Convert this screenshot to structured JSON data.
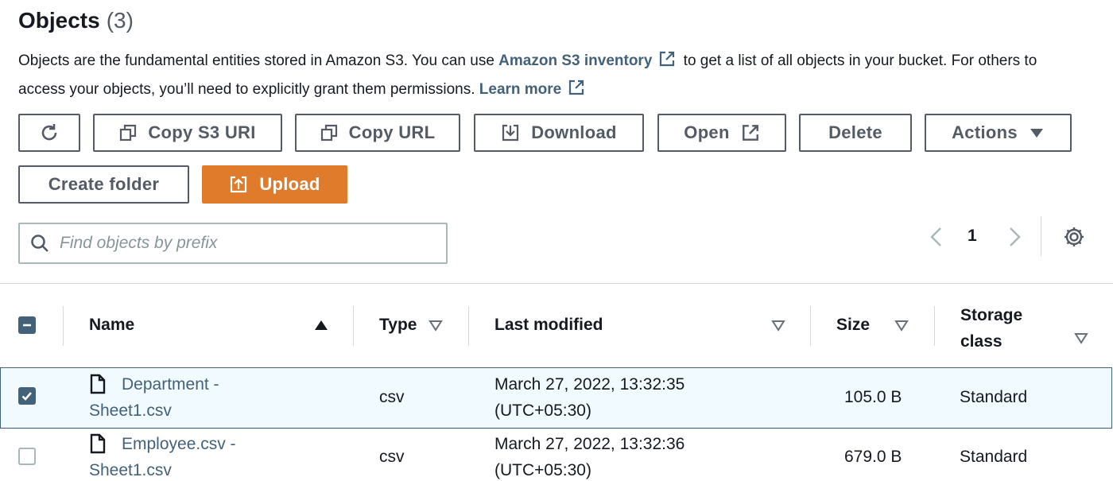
{
  "header": {
    "title": "Objects",
    "count": "(3)"
  },
  "description": {
    "text1": "Objects are the fundamental entities stored in Amazon S3. You can use",
    "inventory_link": "Amazon S3 inventory",
    "text2": "to get a list of all objects in your bucket. For others to access your objects, you’ll need to explicitly grant them permissions.",
    "learn_more": "Learn more"
  },
  "toolbar": {
    "copy_s3_uri": "Copy S3 URI",
    "copy_url": "Copy URL",
    "download": "Download",
    "open": "Open",
    "delete": "Delete",
    "actions": "Actions",
    "create_folder": "Create folder",
    "upload": "Upload"
  },
  "search": {
    "placeholder": "Find objects by prefix"
  },
  "pagination": {
    "current_page": "1"
  },
  "table": {
    "columns": {
      "name": "Name",
      "type": "Type",
      "last_modified": "Last modified",
      "size": "Size",
      "storage_class_1": "Storage",
      "storage_class_2": "class"
    },
    "rows": [
      {
        "name_1": "Department -",
        "name_2": "Sheet1.csv",
        "type": "csv",
        "modified_1": "March 27, 2022, 13:32:35",
        "modified_2": "(UTC+05:30)",
        "size": "105.0 B",
        "storage_class": "Standard",
        "selected": true
      },
      {
        "name_1": "Employee.csv -",
        "name_2": "Sheet1.csv",
        "type": "csv",
        "modified_1": "March 27, 2022, 13:32:36",
        "modified_2": "(UTC+05:30)",
        "size": "679.0 B",
        "storage_class": "Standard",
        "selected": false
      }
    ]
  },
  "colors": {
    "accent": "#e07b2b",
    "link": "#44617a",
    "selected_row": "#f1faff"
  }
}
